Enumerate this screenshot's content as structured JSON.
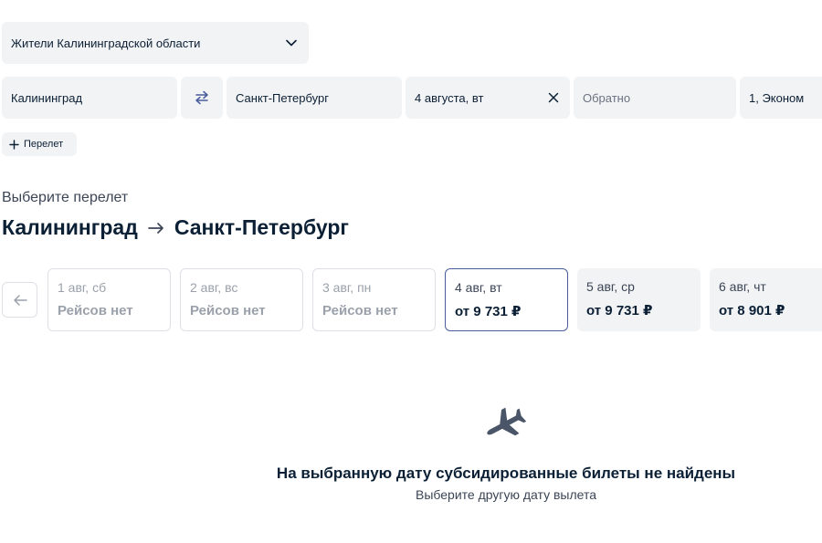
{
  "region_select": {
    "value": "Жители Калининградской области",
    "icon": "chevron-down-icon"
  },
  "search": {
    "from": "Калининград",
    "swap_icon": "swap-icon",
    "to": "Санкт-Петербург",
    "date": "4 августа, вт",
    "clear_icon": "close-icon",
    "return_placeholder": "Обратно",
    "passengers": "1, Эконом"
  },
  "add_flight": {
    "label": "Перелет",
    "icon": "plus-icon"
  },
  "heading": {
    "subtitle": "Выберите перелет",
    "from": "Калининград",
    "to": "Санкт-Петербург"
  },
  "dates": [
    {
      "date": "1 авг, сб",
      "price": "Рейсов нет",
      "state": "empty"
    },
    {
      "date": "2 авг, вс",
      "price": "Рейсов нет",
      "state": "empty"
    },
    {
      "date": "3 авг, пн",
      "price": "Рейсов нет",
      "state": "empty"
    },
    {
      "date": "4 авг, вт",
      "price": "от 9 731 ₽",
      "state": "selected"
    },
    {
      "date": "5 авг, ср",
      "price": "от 9 731 ₽",
      "state": "priced"
    },
    {
      "date": "6 авг, чт",
      "price": "от 8 901 ₽",
      "state": "priced"
    }
  ],
  "empty_state": {
    "icon": "airplane-icon",
    "title": "На выбранную дату субсидированные билеты не найдены",
    "subtitle": "Выберите другую дату вылета"
  },
  "colors": {
    "field_bg": "#f2f3f5",
    "text": "#0b1f35",
    "accent": "#4b5d9c",
    "muted": "#9aa1ab"
  }
}
